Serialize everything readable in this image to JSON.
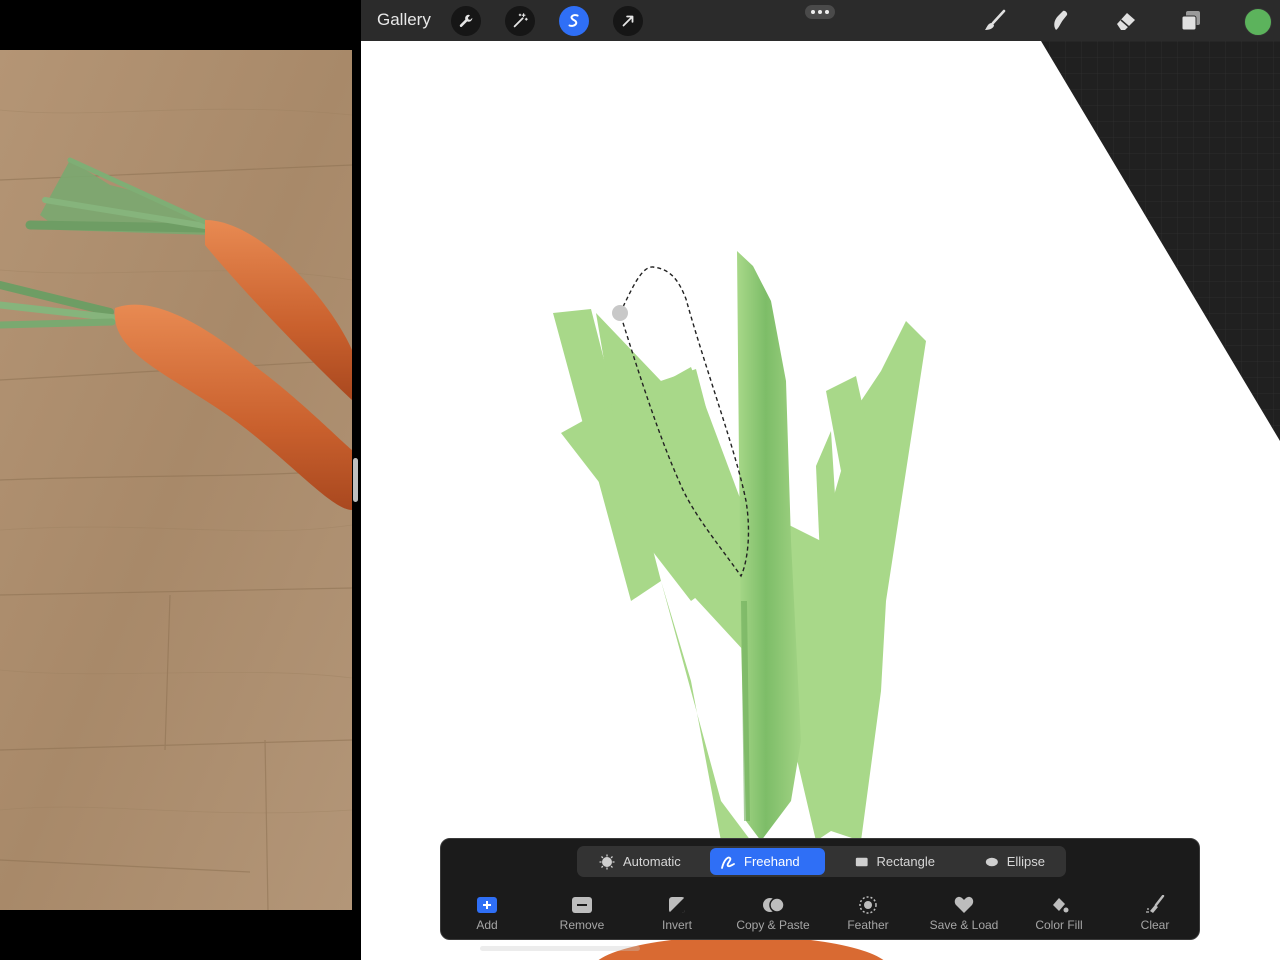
{
  "toolbar": {
    "gallery_label": "Gallery",
    "left_tools": [
      {
        "icon": "wrench-icon",
        "active": false
      },
      {
        "icon": "magic-wand-icon",
        "active": false
      },
      {
        "icon": "selection-icon",
        "active": true
      },
      {
        "icon": "arrow-transform-icon",
        "active": false
      }
    ],
    "right_tools": [
      "brush-icon",
      "smudge-icon",
      "eraser-icon",
      "layers-icon"
    ],
    "current_color": "#5cb35c"
  },
  "selection_panel": {
    "modes": [
      {
        "label": "Automatic",
        "icon": "automatic-icon",
        "active": false
      },
      {
        "label": "Freehand",
        "icon": "freehand-icon",
        "active": true
      },
      {
        "label": "Rectangle",
        "icon": "rectangle-icon",
        "active": false
      },
      {
        "label": "Ellipse",
        "icon": "ellipse-icon",
        "active": false
      }
    ],
    "actions": [
      {
        "label": "Add",
        "icon": "add-icon"
      },
      {
        "label": "Remove",
        "icon": "remove-icon"
      },
      {
        "label": "Invert",
        "icon": "invert-icon"
      },
      {
        "label": "Copy & Paste",
        "icon": "copy-paste-icon"
      },
      {
        "label": "Feather",
        "icon": "feather-icon"
      },
      {
        "label": "Save & Load",
        "icon": "save-load-icon"
      },
      {
        "label": "Color Fill",
        "icon": "color-fill-icon"
      },
      {
        "label": "Clear",
        "icon": "clear-icon"
      }
    ]
  },
  "colors": {
    "accent": "#2f6ff6",
    "leaf_green": "#a8d889",
    "dark_green": "#7fbf6a",
    "carrot": "#d96a32"
  }
}
